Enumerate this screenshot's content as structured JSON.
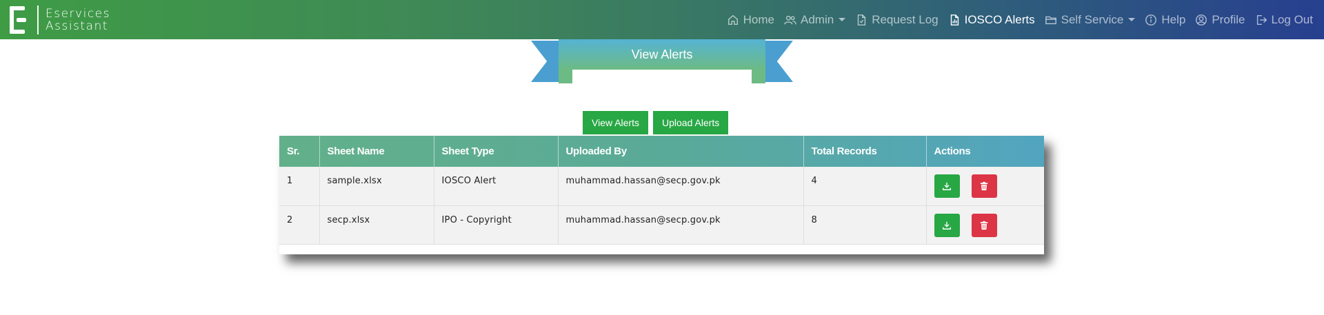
{
  "brand": {
    "line1": "Eservices",
    "line2": "Assistant"
  },
  "nav": {
    "home": "Home",
    "admin": "Admin",
    "request_log": "Request Log",
    "iosco_alerts": "IOSCO Alerts",
    "self_service": "Self Service",
    "help": "Help",
    "profile": "Profile",
    "logout": "Log Out",
    "active": "IOSCO Alerts"
  },
  "banner": {
    "title": "View Alerts"
  },
  "buttons": {
    "view_alerts": "View Alerts",
    "upload_alerts": "Upload Alerts"
  },
  "table": {
    "headers": [
      "Sr.",
      "Sheet Name",
      "Sheet Type",
      "Uploaded By",
      "Total Records",
      "Actions"
    ],
    "rows": [
      {
        "sr": "1",
        "sheet_name": "sample.xlsx",
        "sheet_type": "IOSCO Alert",
        "uploaded_by": "muhammad.hassan@secp.gov.pk",
        "total_records": "4"
      },
      {
        "sr": "2",
        "sheet_name": "secp.xlsx",
        "sheet_type": "IPO - Copyright",
        "uploaded_by": "muhammad.hassan@secp.gov.pk",
        "total_records": "8"
      }
    ],
    "action_icons": [
      "download-icon",
      "trash-icon"
    ]
  },
  "colors": {
    "nav_gradient_start": "#3f9c45",
    "nav_gradient_end": "#273f8f",
    "header_start": "#62b08a",
    "header_end": "#52a5bf",
    "success": "#28a745",
    "danger": "#dc3545",
    "ribbon_tail": "#4a9fd0"
  }
}
